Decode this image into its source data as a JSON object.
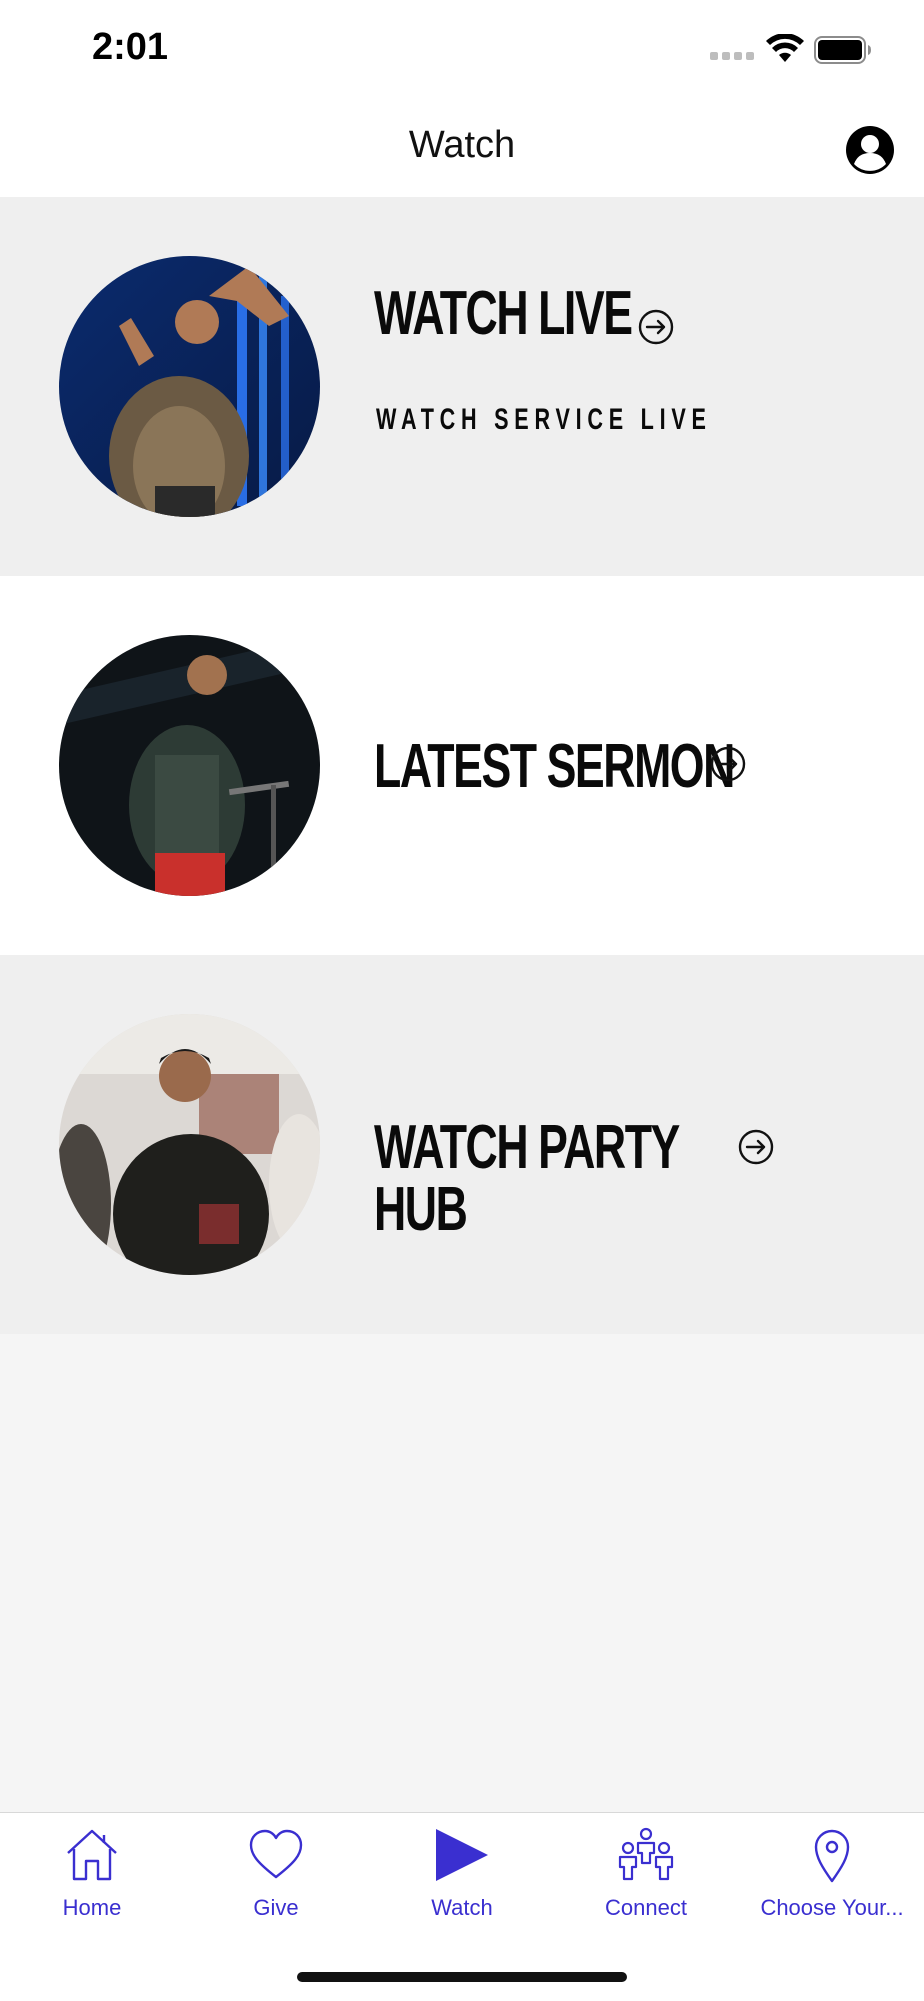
{
  "status_bar": {
    "time": "2:01"
  },
  "nav": {
    "title": "Watch",
    "profile_icon": "user-circle-icon"
  },
  "rows": [
    {
      "title": "WATCH LIVE",
      "subtitle": "WATCH SERVICE LIVE",
      "image": "pastor-on-stage-blue-lights",
      "arrow_icon": "arrow-right-circle-icon"
    },
    {
      "title": "LATEST SERMON",
      "subtitle": "",
      "image": "pastor-preaching-dark-stage",
      "arrow_icon": "arrow-right-circle-icon"
    },
    {
      "title": "WATCH PARTY HUB",
      "subtitle": "",
      "image": "people-greeting-lobby",
      "arrow_icon": "arrow-right-circle-icon"
    }
  ],
  "tabs": [
    {
      "label": "Home",
      "icon": "home-icon"
    },
    {
      "label": "Give",
      "icon": "heart-icon"
    },
    {
      "label": "Watch",
      "icon": "play-icon"
    },
    {
      "label": "Connect",
      "icon": "people-icon"
    },
    {
      "label": "Choose Your...",
      "icon": "location-pin-icon"
    }
  ],
  "colors": {
    "accent": "#3a2fd0",
    "row_alt_bg": "#efefef",
    "page_bg": "#f5f5f5"
  }
}
